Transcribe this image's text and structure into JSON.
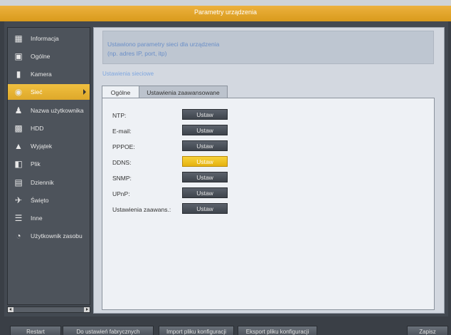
{
  "window": {
    "title": "Parametry urządzenia"
  },
  "sidebar": {
    "items": [
      {
        "label": "Informacja",
        "icon": "info-icon"
      },
      {
        "label": "Ogólne",
        "icon": "general-icon"
      },
      {
        "label": "Kamera",
        "icon": "camera-icon"
      },
      {
        "label": "Sieć",
        "icon": "network-icon",
        "active": true
      },
      {
        "label": "Nazwa użytkownika",
        "icon": "user-icon"
      },
      {
        "label": "HDD",
        "icon": "hdd-icon"
      },
      {
        "label": "Wyjątek",
        "icon": "warning-icon"
      },
      {
        "label": "Plik",
        "icon": "file-icon"
      },
      {
        "label": "Dziennik",
        "icon": "log-icon"
      },
      {
        "label": "Święto",
        "icon": "holiday-icon"
      },
      {
        "label": "Inne",
        "icon": "other-icon"
      },
      {
        "label": "Użytkownik zasobu",
        "icon": "resource-user-icon"
      }
    ]
  },
  "main": {
    "info_line1": "Ustawiono parametry sieci dla urządzenia",
    "info_line2": "(np. adres IP, port, itp)",
    "section_label": "Ustawienia sieciowe",
    "tabs": [
      {
        "label": "Ogólne",
        "active": true
      },
      {
        "label": "Ustawienia zaawansowane",
        "active": false
      }
    ],
    "rows": [
      {
        "label": "NTP:",
        "button": "Ustaw",
        "highlighted": false
      },
      {
        "label": "E-mail:",
        "button": "Ustaw",
        "highlighted": false
      },
      {
        "label": "PPPOE:",
        "button": "Ustaw",
        "highlighted": false
      },
      {
        "label": "DDNS:",
        "button": "Ustaw",
        "highlighted": true
      },
      {
        "label": "SNMP:",
        "button": "Ustaw",
        "highlighted": false
      },
      {
        "label": "UPnP:",
        "button": "Ustaw",
        "highlighted": false
      },
      {
        "label": "Ustawienia zaawans.:",
        "button": "Ustaw",
        "highlighted": false
      }
    ]
  },
  "footer": {
    "restart": "Restart",
    "factory_defaults": "Do ustawień fabrycznych",
    "import_config": "Import pliku konfiguracji",
    "export_config": "Eksport pliku konfiguracji",
    "save": "Zapisz"
  },
  "colors": {
    "accent": "#e5b20f",
    "title_bar": "#d99a1c",
    "info_text": "#6a8fc8"
  }
}
